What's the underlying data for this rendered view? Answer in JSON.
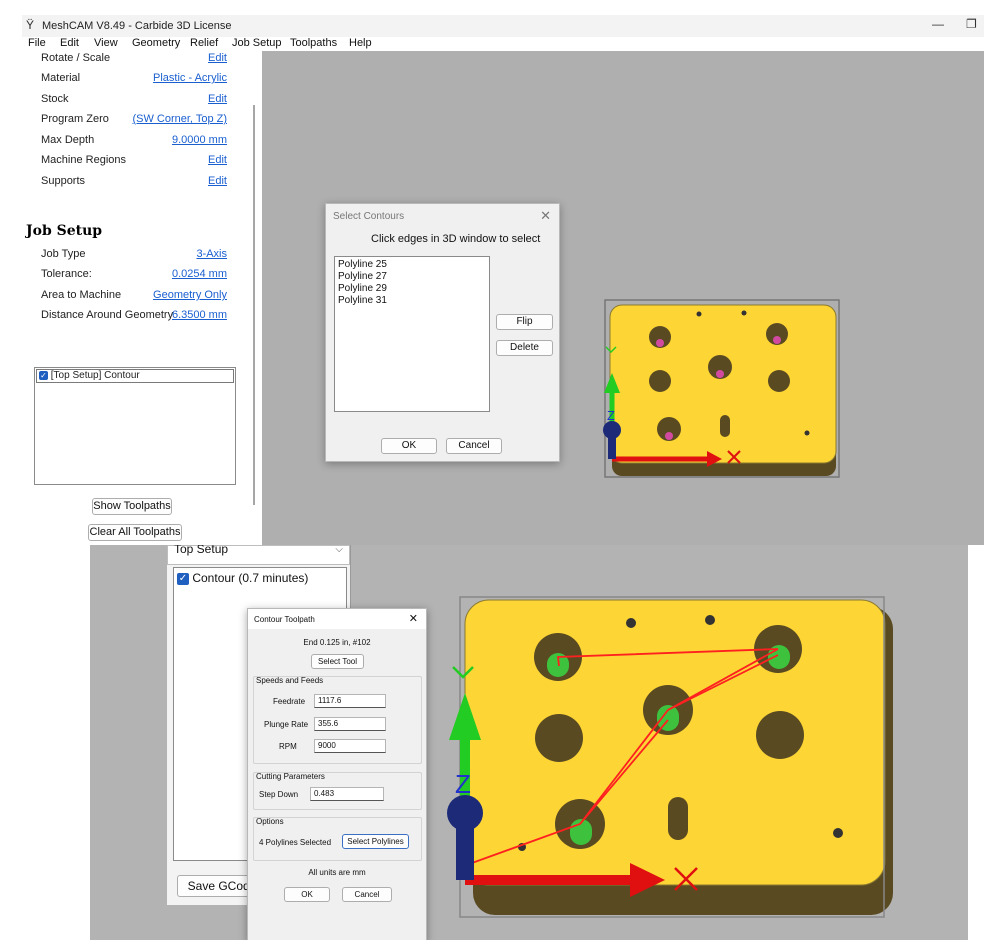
{
  "window": {
    "title": "MeshCAM V8.49 - Carbide 3D License",
    "minimize_glyph": "—",
    "restore_glyph": "❐"
  },
  "menu": [
    "File",
    "Edit",
    "View",
    "Geometry",
    "Relief",
    "Job Setup",
    "Toolpaths",
    "Help"
  ],
  "setup_rows": [
    {
      "label": "Rotate / Scale",
      "value": "Edit"
    },
    {
      "label": "Material",
      "value": "Plastic - Acrylic"
    },
    {
      "label": "Stock",
      "value": "Edit"
    },
    {
      "label": "Program Zero",
      "value": "(SW Corner, Top Z)"
    },
    {
      "label": "Max Depth",
      "value": "9.0000 mm"
    },
    {
      "label": "Machine Regions",
      "value": "Edit"
    },
    {
      "label": "Supports",
      "value": "Edit"
    }
  ],
  "job_setup": {
    "heading": "Job Setup",
    "rows": [
      {
        "label": "Job Type",
        "value": "3-Axis"
      },
      {
        "label": "Tolerance:",
        "value": "0.0254 mm"
      },
      {
        "label": "Area to Machine",
        "value": "Geometry Only"
      },
      {
        "label": "Distance Around Geometry",
        "value": "6.3500 mm"
      }
    ]
  },
  "toolpath_list": {
    "item": "[Top Setup]   Contour"
  },
  "buttons": {
    "show_toolpaths": "Show Toolpaths",
    "clear_all_toolpaths": "Clear All Toolpaths"
  },
  "select_contours": {
    "title": "Select Contours",
    "instruction": "Click edges in 3D window to select",
    "items": [
      "Polyline 25",
      "Polyline 27",
      "Polyline 29",
      "Polyline 31"
    ],
    "flip": "Flip",
    "delete": "Delete",
    "ok": "OK",
    "cancel": "Cancel"
  },
  "bottom": {
    "setup_dropdown": "Top Setup",
    "toolpath_item": "Contour (0.7 minutes)",
    "save_gcode": "Save GCode"
  },
  "contour_toolpath": {
    "title": "Contour Toolpath",
    "tool": "End 0.125 in, #102",
    "select_tool": "Select Tool",
    "speeds_group": "Speeds and Feeds",
    "feedrate_label": "Feedrate",
    "feedrate": "1117.6",
    "plunge_label": "Plunge Rate",
    "plunge": "355.6",
    "rpm_label": "RPM",
    "rpm": "9000",
    "cutting_group": "Cutting Parameters",
    "stepdown_label": "Step Down",
    "stepdown": "0.483",
    "options_group": "Options",
    "polylines_selected": "4 Polylines Selected",
    "select_polylines": "Select Polylines",
    "units_note": "All units are mm",
    "ok": "OK",
    "cancel": "Cancel"
  },
  "colors": {
    "part_face": "#fdd535",
    "part_side": "#5a4a22",
    "link": "#1a5fd0",
    "view_bg": "#afafaf",
    "axis_x": "#e01010",
    "axis_y": "#22cc22",
    "axis_z": "#1c2a78"
  }
}
